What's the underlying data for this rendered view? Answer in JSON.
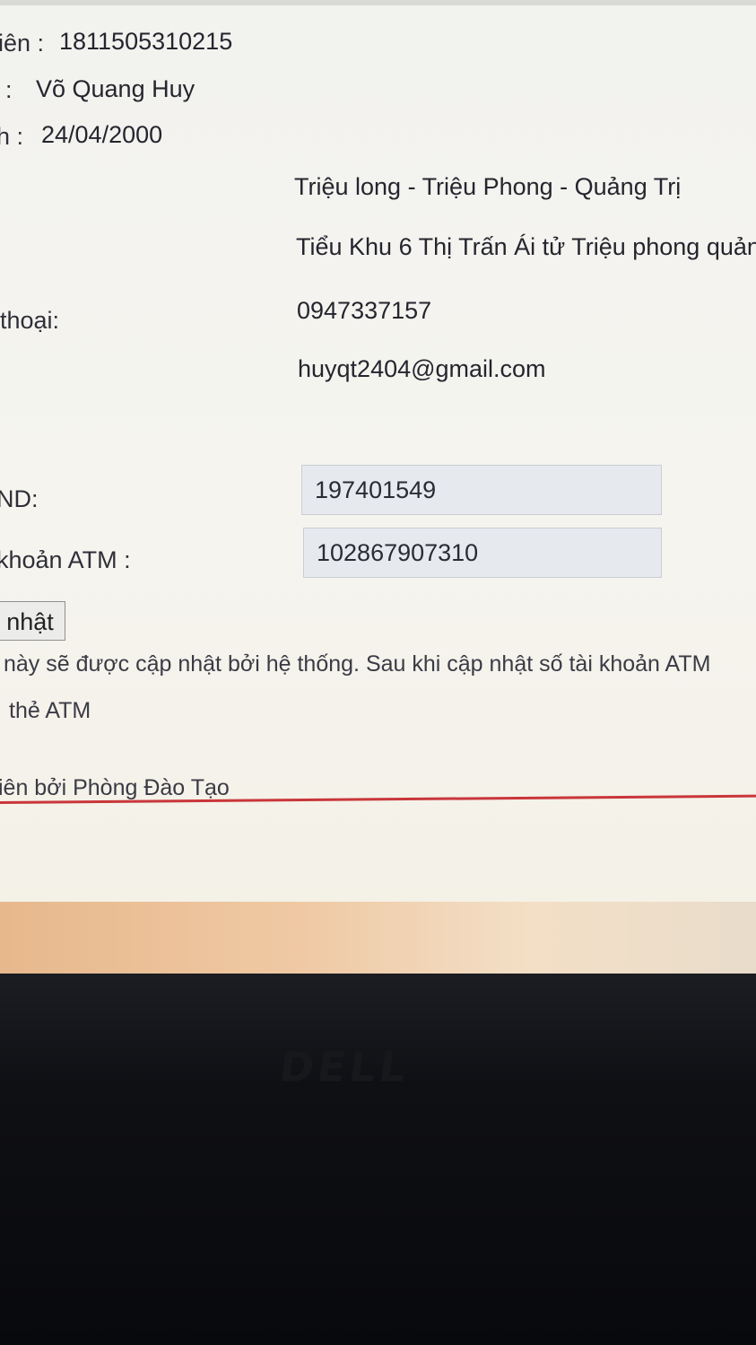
{
  "profile": {
    "student_id_label": "iên :",
    "student_id": "1811505310215",
    "name_label": ":",
    "name": "Võ Quang Huy",
    "dob_label": "h :",
    "dob": "24/04/2000",
    "hometown": "Triệu long - Triệu Phong - Quảng Trị",
    "address": "Tiểu Khu 6 Thị Trấn Ái tử Triệu phong quản",
    "phone_label": "thoại:",
    "phone": "0947337157",
    "email": "huyqt2404@gmail.com",
    "id_card_label": "ND:",
    "id_card": "197401549",
    "atm_label": "khoản ATM :",
    "atm": "102867907310"
  },
  "update_button_label": "nhật",
  "notes": {
    "line1": "này sẽ được cập nhật bởi hệ thống. Sau khi cập nhật số tài khoản ATM",
    "line2": "thẻ ATM",
    "footer": "iên bởi Phòng Đào Tạo"
  },
  "device": {
    "logo": "DELL"
  },
  "colors": {
    "accent_line": "#c9363a",
    "field_bg": "#e6e9ed",
    "screen_bg": "#f3f2ee",
    "bezel": "#0f1014"
  }
}
